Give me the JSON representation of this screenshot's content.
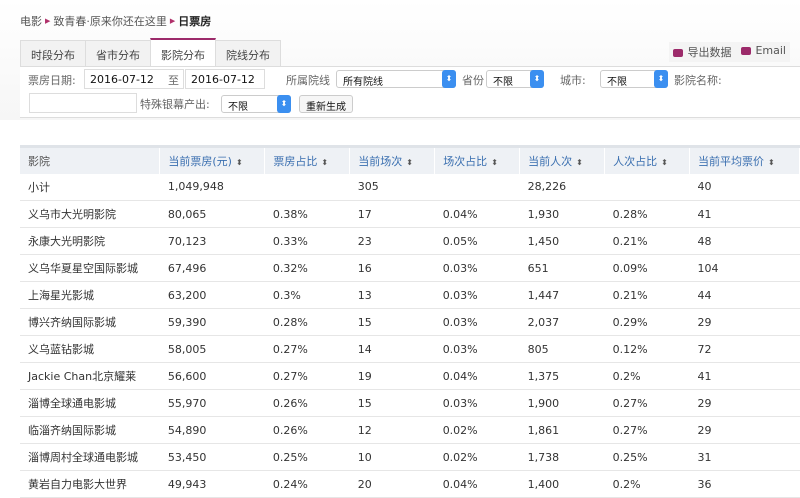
{
  "breadcrumb": {
    "items": [
      "电影",
      "致青春·原来你还在这里"
    ],
    "current": "日票房"
  },
  "tabs": [
    "时段分布",
    "省市分布",
    "影院分布",
    "院线分布"
  ],
  "actions": {
    "export": "导出数据",
    "email": "Email"
  },
  "filters": {
    "date_label": "票房日期:",
    "date_from": "2016-07-12",
    "to_label": "至",
    "date_to": "2016-07-12",
    "chain_label": "所属院线",
    "chain_value": "所有院线",
    "province_label": "省份",
    "province_value": "不限",
    "city_label": "城市:",
    "city_value": "不限",
    "cinema_label": "影院名称:",
    "cinema_value": "",
    "screen_label": "特殊银幕产出:",
    "screen_value": "不限",
    "regenerate": "重新生成"
  },
  "table": {
    "headers": [
      "影院",
      "当前票房(元)",
      "票房占比",
      "当前场次",
      "场次占比",
      "当前人次",
      "人次占比",
      "当前平均票价"
    ],
    "rows": [
      [
        "小计",
        "1,049,948",
        "",
        "305",
        "",
        "28,226",
        "",
        "40"
      ],
      [
        "义乌市大光明影院",
        "80,065",
        "0.38%",
        "17",
        "0.04%",
        "1,930",
        "0.28%",
        "41"
      ],
      [
        "永康大光明影院",
        "70,123",
        "0.33%",
        "23",
        "0.05%",
        "1,450",
        "0.21%",
        "48"
      ],
      [
        "义乌华夏星空国际影城",
        "67,496",
        "0.32%",
        "16",
        "0.03%",
        "651",
        "0.09%",
        "104"
      ],
      [
        "上海星光影城",
        "63,200",
        "0.3%",
        "13",
        "0.03%",
        "1,447",
        "0.21%",
        "44"
      ],
      [
        "博兴齐纳国际影城",
        "59,390",
        "0.28%",
        "15",
        "0.03%",
        "2,037",
        "0.29%",
        "29"
      ],
      [
        "义乌蓝钻影城",
        "58,005",
        "0.27%",
        "14",
        "0.03%",
        "805",
        "0.12%",
        "72"
      ],
      [
        "Jackie Chan北京耀莱",
        "56,600",
        "0.27%",
        "19",
        "0.04%",
        "1,375",
        "0.2%",
        "41"
      ],
      [
        "淄博全球通电影城",
        "55,970",
        "0.26%",
        "15",
        "0.03%",
        "1,900",
        "0.27%",
        "29"
      ],
      [
        "临淄齐纳国际影城",
        "54,890",
        "0.26%",
        "12",
        "0.02%",
        "1,861",
        "0.27%",
        "29"
      ],
      [
        "淄博周村全球通电影城",
        "53,450",
        "0.25%",
        "10",
        "0.02%",
        "1,738",
        "0.25%",
        "31"
      ],
      [
        "黄岩自力电影大世界",
        "49,943",
        "0.24%",
        "20",
        "0.04%",
        "1,400",
        "0.2%",
        "36"
      ]
    ]
  }
}
